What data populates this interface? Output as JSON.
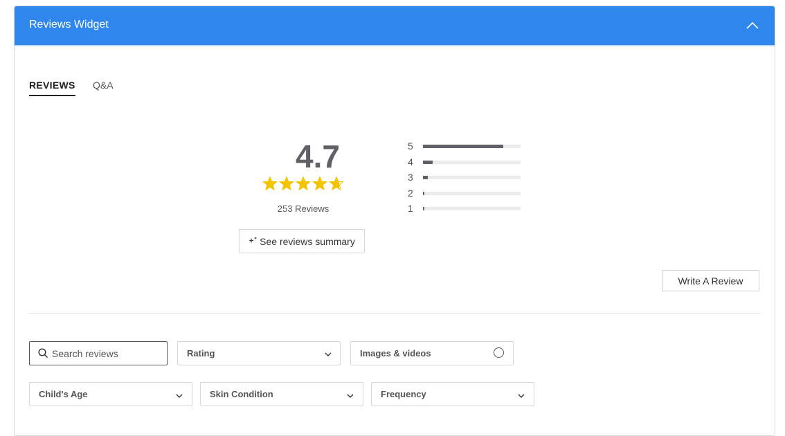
{
  "header": {
    "title": "Reviews Widget",
    "collapse_icon": "chevron-up-icon"
  },
  "tabs": [
    {
      "label": "REVIEWS",
      "active": true
    },
    {
      "label": "Q&A",
      "active": false
    }
  ],
  "summary": {
    "average": "4.7",
    "stars_value": 4.7,
    "stars_max": 5,
    "star_color": "#f5c400",
    "count_text": "253 Reviews",
    "summary_button": "See reviews summary",
    "summary_icon": "sparkle-icon"
  },
  "distribution": [
    {
      "label": "5",
      "fraction": 0.82
    },
    {
      "label": "4",
      "fraction": 0.1
    },
    {
      "label": "3",
      "fraction": 0.05
    },
    {
      "label": "2",
      "fraction": 0.015
    },
    {
      "label": "1",
      "fraction": 0.015
    }
  ],
  "write_review_label": "Write A Review",
  "search": {
    "placeholder": "Search reviews",
    "value": ""
  },
  "filters": {
    "rating": "Rating",
    "media": "Images & videos",
    "childs_age": "Child's Age",
    "skin_condition": "Skin Condition",
    "frequency": "Frequency"
  },
  "colors": {
    "header_bg": "#2f86ec",
    "bar_fill": "#5f6166",
    "bar_track": "#ebebeb"
  }
}
